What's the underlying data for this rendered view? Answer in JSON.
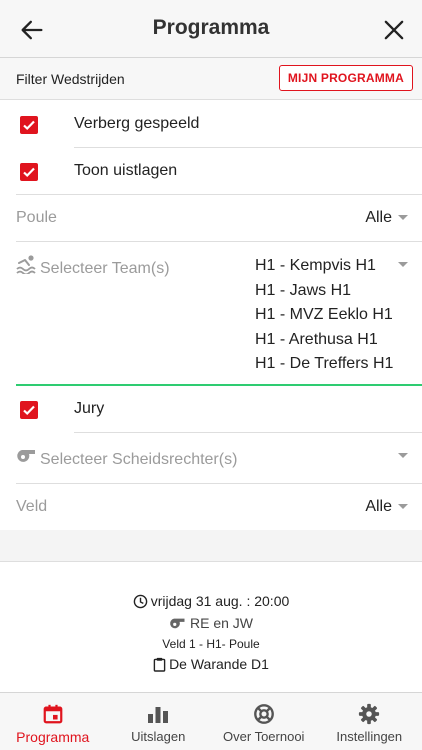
{
  "header": {
    "title": "Programma"
  },
  "filterbar": {
    "label": "Filter Wedstrijden",
    "mine_button": "MIJN PROGRAMMA"
  },
  "filters": {
    "hide_played": {
      "label": "Verberg gespeeld",
      "checked": true
    },
    "show_results": {
      "label": "Toon uistlagen",
      "checked": true
    },
    "poule": {
      "label": "Poule",
      "value": "Alle"
    },
    "team": {
      "placeholder": "Selecteer Team(s)",
      "selected": [
        "H1 - Kempvis H1",
        "H1 - Jaws H1",
        "H1 - MVZ Eeklo H1",
        "H1 - Arethusa H1",
        "H1 - De Treffers H1"
      ]
    },
    "jury": {
      "label": "Jury",
      "checked": true
    },
    "referee": {
      "placeholder": "Selecteer Scheidsrechter(s)"
    },
    "field": {
      "label": "Veld",
      "value": "Alle"
    }
  },
  "match": {
    "datetime": "vrijdag 31 aug. : 20:00",
    "referees": "RE en JW",
    "info": "Veld 1 - H1- Poule",
    "location": "De Warande D1"
  },
  "tabs": [
    {
      "label": "Programma",
      "icon": "calendar-icon",
      "active": true
    },
    {
      "label": "Uitslagen",
      "icon": "bar-chart-icon",
      "active": false
    },
    {
      "label": "Over Toernooi",
      "icon": "lifebuoy-icon",
      "active": false
    },
    {
      "label": "Instellingen",
      "icon": "gear-icon",
      "active": false
    }
  ],
  "colors": {
    "accent": "#e0141e",
    "valid": "#2ecc71",
    "muted": "#9b9b9b"
  }
}
